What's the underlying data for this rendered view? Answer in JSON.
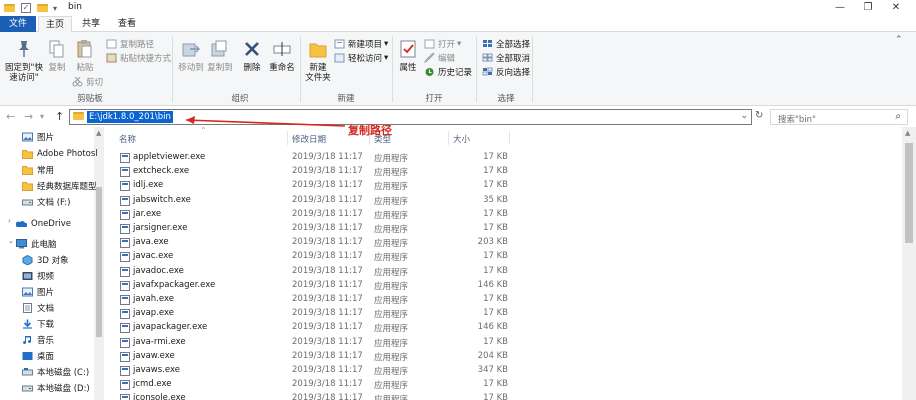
{
  "window": {
    "title": "bin",
    "controls": [
      "—",
      "❐",
      "✕"
    ]
  },
  "ribbon_tabs": [
    {
      "label": "文件"
    },
    {
      "label": "主页"
    },
    {
      "label": "共享"
    },
    {
      "label": "查看"
    }
  ],
  "ribbon": {
    "clipboard": {
      "pin_label": "固定到\"快\n速访问\"",
      "copy_label": "复制",
      "paste_label": "粘贴",
      "copy_path": "复制路径",
      "paste_shortcut": "粘贴快捷方式",
      "cut": "剪切",
      "group": "剪贴板"
    },
    "organize": {
      "move_to": "移动到",
      "copy_to": "复制到",
      "delete": "删除",
      "rename": "重命名",
      "group": "组织"
    },
    "new": {
      "new_folder": "新建\n文件夹",
      "new_item": "新建项目",
      "easy_access": "轻松访问",
      "group": "新建"
    },
    "open": {
      "properties": "属性",
      "open": "打开",
      "edit": "编辑",
      "history": "历史记录",
      "group": "打开"
    },
    "select": {
      "select_all": "全部选择",
      "select_none": "全部取消",
      "invert": "反向选择",
      "group": "选择"
    }
  },
  "address": {
    "path": "E:\\jdk1.8.0_201\\bin",
    "search_placeholder": "搜索\"bin\""
  },
  "annotation": "复制路径",
  "nav_items": [
    {
      "label": "图片",
      "icon": "pictures-icon"
    },
    {
      "label": "Adobe Photosl",
      "icon": "folder-icon"
    },
    {
      "label": "常用",
      "icon": "folder-icon"
    },
    {
      "label": "经典数据库题型",
      "icon": "folder-icon"
    },
    {
      "label": "文档 (F:)",
      "icon": "drive-icon"
    },
    {
      "label": "OneDrive",
      "icon": "onedrive-icon"
    },
    {
      "label": "此电脑",
      "icon": "pc-icon"
    },
    {
      "label": "3D 对象",
      "icon": "3d-objects-icon"
    },
    {
      "label": "视频",
      "icon": "videos-icon"
    },
    {
      "label": "图片",
      "icon": "pictures-icon"
    },
    {
      "label": "文档",
      "icon": "documents-icon"
    },
    {
      "label": "下载",
      "icon": "downloads-icon"
    },
    {
      "label": "音乐",
      "icon": "music-icon"
    },
    {
      "label": "桌面",
      "icon": "desktop-icon"
    },
    {
      "label": "本地磁盘 (C:)",
      "icon": "drive-icon"
    },
    {
      "label": "本地磁盘 (D:)",
      "icon": "drive-icon"
    }
  ],
  "columns": {
    "name": "名称",
    "date": "修改日期",
    "type": "类型",
    "size": "大小"
  },
  "files": [
    {
      "name": "appletviewer.exe",
      "date": "2019/3/18 11:17",
      "type": "应用程序",
      "size": "17 KB"
    },
    {
      "name": "extcheck.exe",
      "date": "2019/3/18 11:17",
      "type": "应用程序",
      "size": "17 KB"
    },
    {
      "name": "idlj.exe",
      "date": "2019/3/18 11:17",
      "type": "应用程序",
      "size": "17 KB"
    },
    {
      "name": "jabswitch.exe",
      "date": "2019/3/18 11:17",
      "type": "应用程序",
      "size": "35 KB"
    },
    {
      "name": "jar.exe",
      "date": "2019/3/18 11:17",
      "type": "应用程序",
      "size": "17 KB"
    },
    {
      "name": "jarsigner.exe",
      "date": "2019/3/18 11:17",
      "type": "应用程序",
      "size": "17 KB"
    },
    {
      "name": "java.exe",
      "date": "2019/3/18 11:17",
      "type": "应用程序",
      "size": "203 KB"
    },
    {
      "name": "javac.exe",
      "date": "2019/3/18 11:17",
      "type": "应用程序",
      "size": "17 KB"
    },
    {
      "name": "javadoc.exe",
      "date": "2019/3/18 11:17",
      "type": "应用程序",
      "size": "17 KB"
    },
    {
      "name": "javafxpackager.exe",
      "date": "2019/3/18 11:17",
      "type": "应用程序",
      "size": "146 KB"
    },
    {
      "name": "javah.exe",
      "date": "2019/3/18 11:17",
      "type": "应用程序",
      "size": "17 KB"
    },
    {
      "name": "javap.exe",
      "date": "2019/3/18 11:17",
      "type": "应用程序",
      "size": "17 KB"
    },
    {
      "name": "javapackager.exe",
      "date": "2019/3/18 11:17",
      "type": "应用程序",
      "size": "146 KB"
    },
    {
      "name": "java-rmi.exe",
      "date": "2019/3/18 11:17",
      "type": "应用程序",
      "size": "17 KB"
    },
    {
      "name": "javaw.exe",
      "date": "2019/3/18 11:17",
      "type": "应用程序",
      "size": "204 KB"
    },
    {
      "name": "javaws.exe",
      "date": "2019/3/18 11:17",
      "type": "应用程序",
      "size": "347 KB"
    },
    {
      "name": "jcmd.exe",
      "date": "2019/3/18 11:17",
      "type": "应用程序",
      "size": "17 KB"
    },
    {
      "name": "jconsole.exe",
      "date": "2019/3/18 11:17",
      "type": "应用程序",
      "size": "17 KB"
    }
  ]
}
